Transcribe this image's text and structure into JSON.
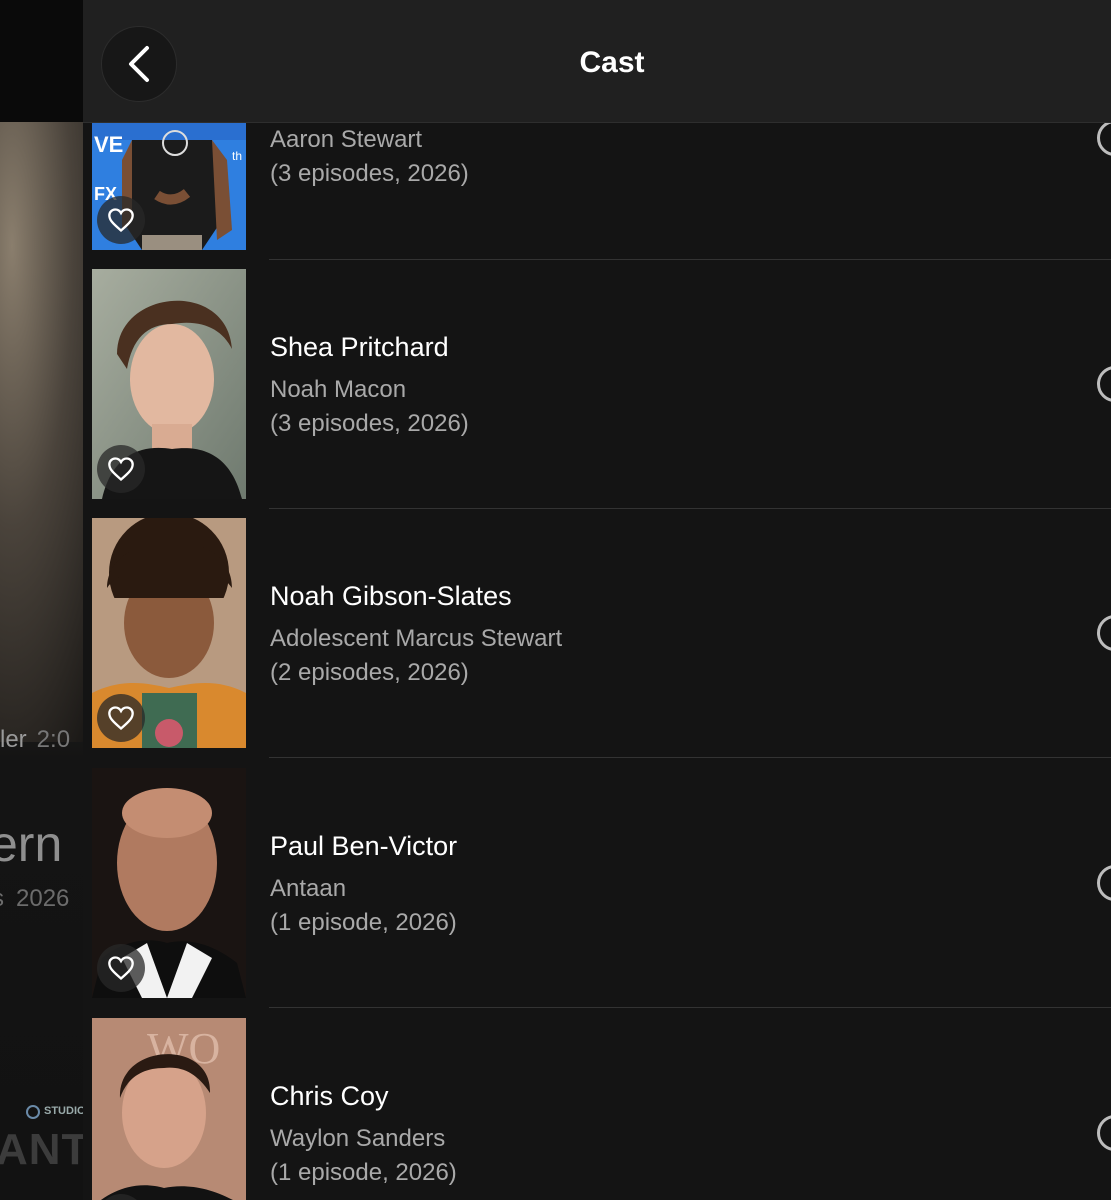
{
  "header": {
    "title": "Cast"
  },
  "background": {
    "meta_label": "ler",
    "meta_duration": "2:0",
    "title_fragment": "ern",
    "sub_fragment": "s",
    "sub_year": "2026",
    "logo_studio": "STUDIO",
    "logo_word": "ANTE"
  },
  "cast": [
    {
      "actor": "",
      "role": "Aaron Stewart",
      "episodes": "(3 episodes, 2026)"
    },
    {
      "actor": "Shea Pritchard",
      "role": "Noah Macon",
      "episodes": "(3 episodes, 2026)"
    },
    {
      "actor": "Noah Gibson-Slates",
      "role": "Adolescent Marcus Stewart",
      "episodes": "(2 episodes, 2026)"
    },
    {
      "actor": "Paul Ben-Victor",
      "role": "Antaan",
      "episodes": "(1 episode, 2026)"
    },
    {
      "actor": "Chris Coy",
      "role": "Waylon Sanders",
      "episodes": "(1 episode, 2026)"
    }
  ],
  "icons": {
    "back": "chevron-left-icon",
    "favorite": "heart-outline-icon",
    "more": "circle-icon"
  },
  "colors": {
    "sheet_bg": "#141414",
    "header_bg": "#202020",
    "secondary_text": "#a9a9a9"
  }
}
